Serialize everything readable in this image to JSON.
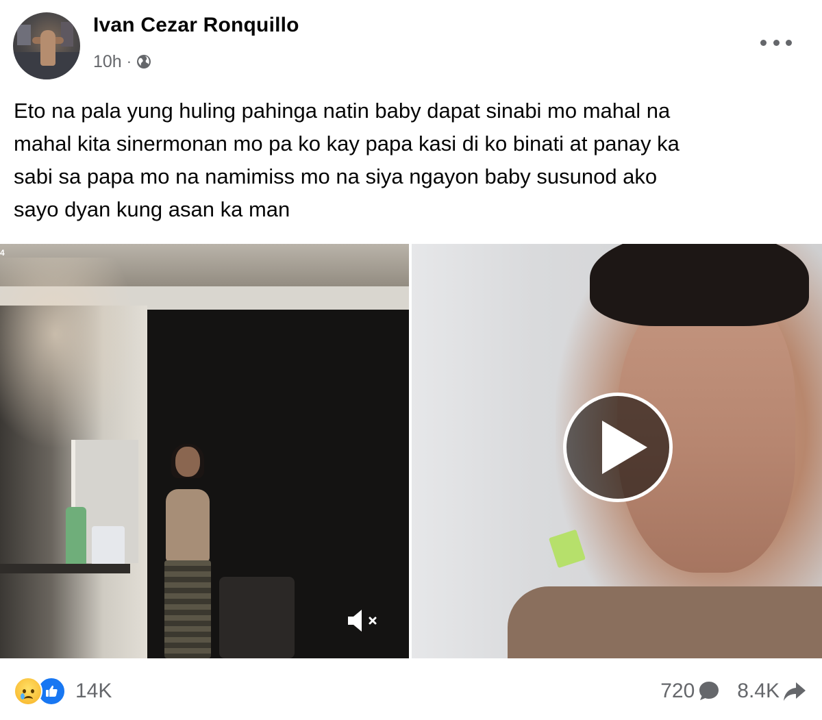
{
  "post": {
    "author": "Ivan Cezar Ronquillo",
    "time": "10h",
    "separator": "·",
    "audience_icon": "globe-icon",
    "more_icon": "more-options-icon",
    "text_lines": [
      "Eto na pala yung huling pahinga natin baby dapat sinabi mo mahal na",
      "mahal kita sinermonan mo pa ko kay papa kasi di ko binati at panay ka",
      "sabi sa papa mo na namimiss mo na siya ngayon baby susunod ako",
      "sayo dyan kung asan ka man"
    ]
  },
  "media": {
    "left_video": {
      "corner_label": "4",
      "mute_icon": "speaker-muted-icon"
    },
    "right_video": {
      "play_icon": "play-icon"
    }
  },
  "footer": {
    "reaction_icons": [
      "sad-reaction-icon",
      "like-reaction-icon"
    ],
    "reaction_count": "14K",
    "comment_count": "720",
    "share_count": "8.4K"
  },
  "colors": {
    "text_primary": "#050505",
    "text_secondary": "#65676b",
    "like_blue": "#1877f2"
  }
}
